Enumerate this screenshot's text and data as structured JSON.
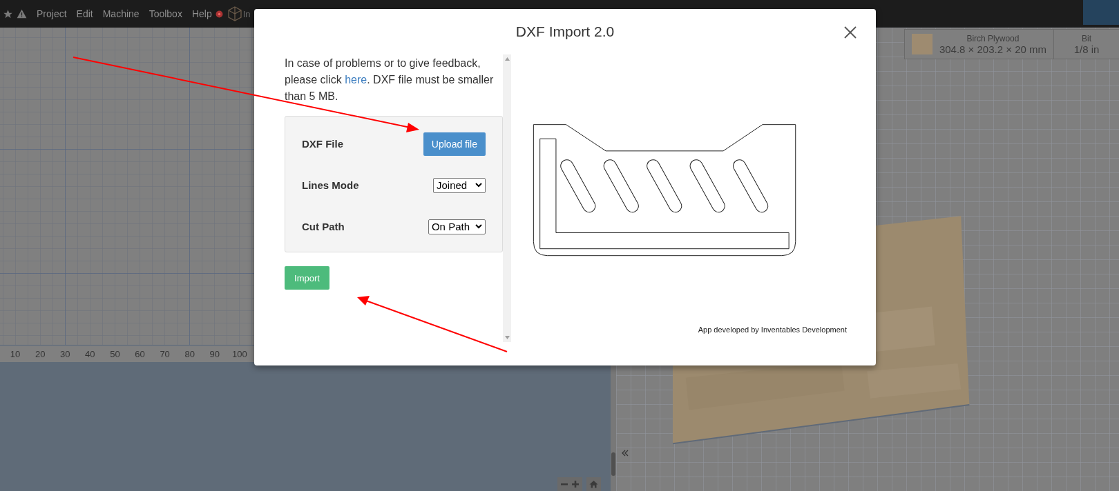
{
  "toolbar": {
    "menu": [
      {
        "label": "Project"
      },
      {
        "label": "Edit"
      },
      {
        "label": "Machine"
      },
      {
        "label": "Toolbox"
      },
      {
        "label": "Help"
      }
    ],
    "logo_text": "In"
  },
  "material": {
    "name": "Birch Plywood",
    "dimensions": "304.8 × 203.2 × 20 mm"
  },
  "bit": {
    "label": "Bit",
    "value": "1/8 in"
  },
  "ruler": {
    "labels": [
      "10",
      "20",
      "30",
      "40",
      "50",
      "60",
      "70",
      "80",
      "90",
      "100"
    ]
  },
  "dialog": {
    "title": "DXF Import 2.0",
    "intro": {
      "before": "In case of problems or to give feedback, please click ",
      "link": "here",
      "after": ". DXF file must be smaller than 5 MB."
    },
    "fields": [
      {
        "kind": "upload",
        "label": "DXF File",
        "button": "Upload file"
      },
      {
        "kind": "select",
        "label": "Lines Mode",
        "value": "Joined"
      },
      {
        "kind": "select",
        "label": "Cut Path",
        "value": "On Path"
      }
    ],
    "import_button": "Import",
    "credit": "App developed by Inventables Development"
  }
}
